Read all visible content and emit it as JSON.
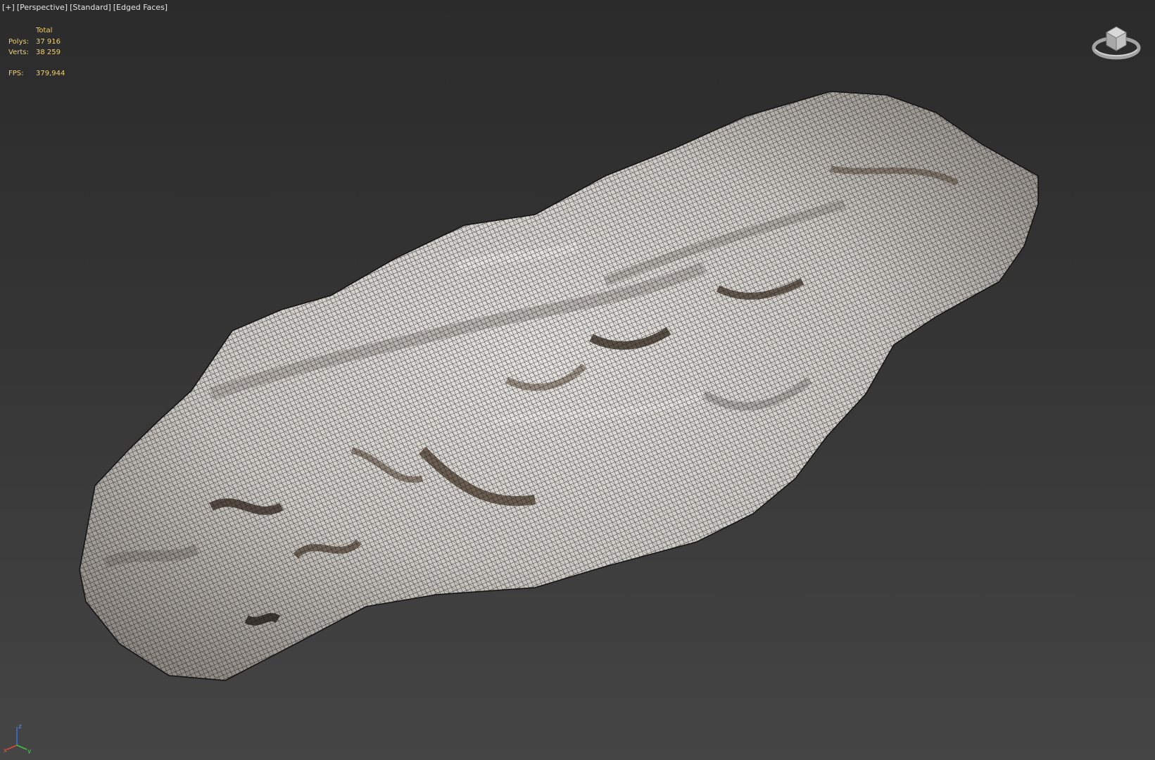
{
  "viewport": {
    "labels": [
      "[+]",
      "[Perspective]",
      "[Standard]",
      "[Edged Faces]"
    ]
  },
  "stats": {
    "header": "Total",
    "polys_label": "Polys:",
    "polys_value": "37 916",
    "verts_label": "Verts:",
    "verts_value": "38 259",
    "fps_label": "FPS:",
    "fps_value": "379,944"
  },
  "colors": {
    "stats_text": "#f0d070",
    "label_text": "#e6e6e6",
    "background_top": "#2b2b2b",
    "background_bottom": "#454545"
  },
  "icons": {
    "viewcube": "viewcube-icon",
    "axis_tripod": "axis-tripod-icon"
  },
  "axis": {
    "z_label": "z",
    "x_label": "x",
    "y_label": "y"
  }
}
